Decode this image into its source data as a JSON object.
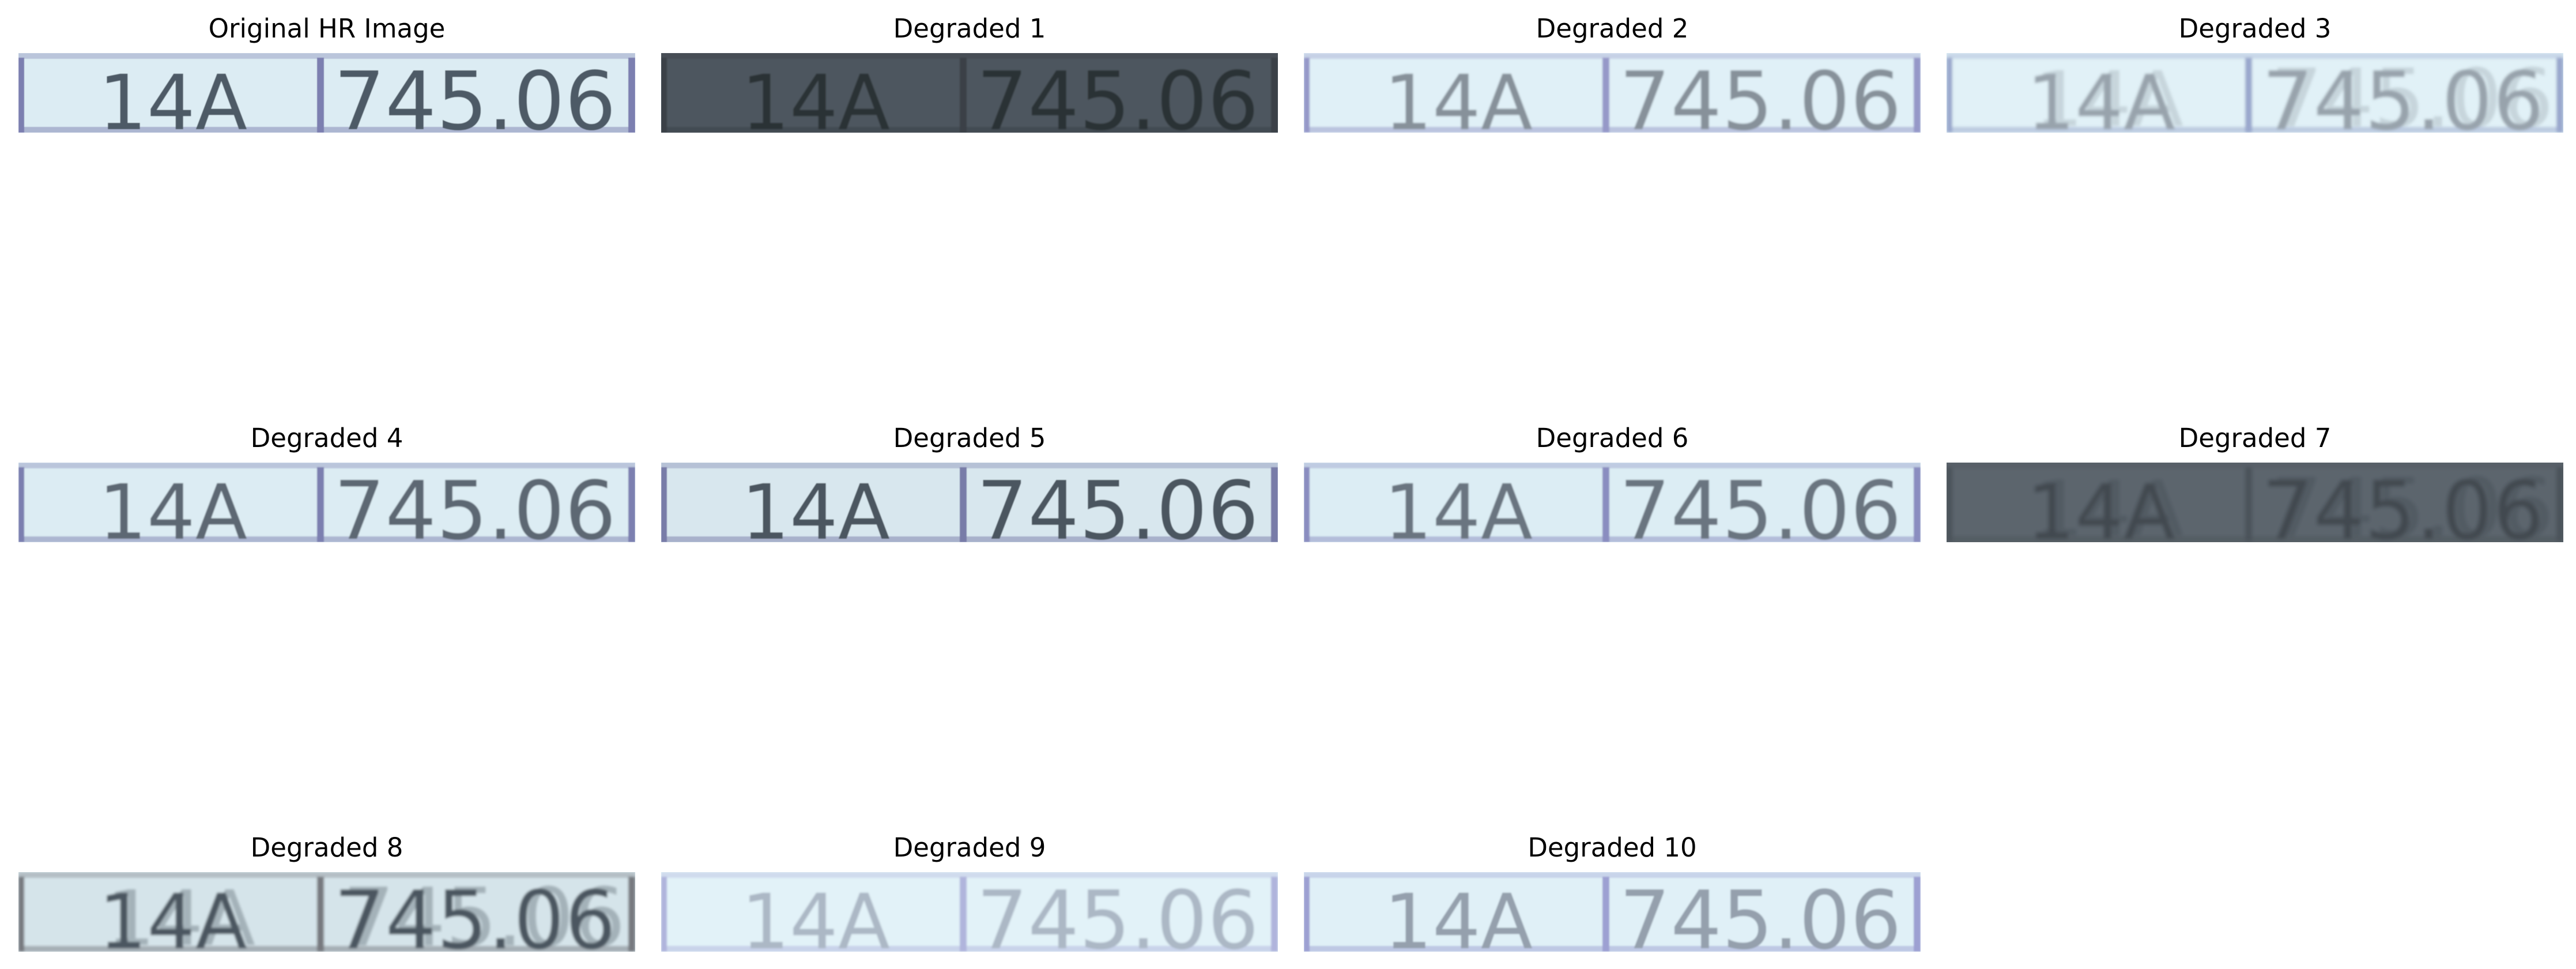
{
  "panels": [
    {
      "title": "Original HR Image",
      "left_text": "14A",
      "right_text": "745.06",
      "bg": "#dcecf3",
      "ink": "#4e5a66",
      "border": "#7b7fb0",
      "blur": 0.6,
      "opacity": 1.0,
      "ghost": false
    },
    {
      "title": "Degraded 1",
      "left_text": "14A",
      "right_text": "745.06",
      "bg": "#4d565e",
      "ink": "#2b3136",
      "border": "#3a4046",
      "blur": 1.2,
      "opacity": 1.0,
      "ghost": false
    },
    {
      "title": "Degraded 2",
      "left_text": "14A",
      "right_text": "745.06",
      "bg": "#e0f0f7",
      "ink": "#7e8791",
      "border": "#8e8fc4",
      "blur": 1.6,
      "opacity": 0.9,
      "ghost": false
    },
    {
      "title": "Degraded 3",
      "left_text": "14A",
      "right_text": "745.06",
      "bg": "#e1f1f7",
      "ink": "#8c96a0",
      "border": "#8e9cc6",
      "blur": 2.4,
      "opacity": 0.85,
      "ghost": true
    },
    {
      "title": "Degraded 4",
      "left_text": "14A",
      "right_text": "745.06",
      "bg": "#dcecf3",
      "ink": "#5d6873",
      "border": "#7b7fb0",
      "blur": 1.0,
      "opacity": 1.0,
      "ghost": false
    },
    {
      "title": "Degraded 5",
      "left_text": "14A",
      "right_text": "745.06",
      "bg": "#d8e7ee",
      "ink": "#4c5661",
      "border": "#787ca8",
      "blur": 0.9,
      "opacity": 1.0,
      "ghost": false
    },
    {
      "title": "Degraded 6",
      "left_text": "14A",
      "right_text": "745.06",
      "bg": "#dcedf4",
      "ink": "#6b7580",
      "border": "#8a8dc0",
      "blur": 1.3,
      "opacity": 1.0,
      "ghost": false
    },
    {
      "title": "Degraded 7",
      "left_text": "14A",
      "right_text": "745.06",
      "bg": "#5c656d",
      "ink": "#3f474e",
      "border": "#4a5158",
      "blur": 3.2,
      "opacity": 0.9,
      "ghost": true
    },
    {
      "title": "Degraded 8",
      "left_text": "14A",
      "right_text": "745.06",
      "bg": "#d5e4ea",
      "ink": "#4c5661",
      "border": "#77797f",
      "blur": 2.2,
      "opacity": 1.0,
      "ghost": true
    },
    {
      "title": "Degraded 9",
      "left_text": "14A",
      "right_text": "745.06",
      "bg": "#e2f2f8",
      "ink": "#a3aebd",
      "border": "#a8aad8",
      "blur": 1.6,
      "opacity": 0.85,
      "ghost": false
    },
    {
      "title": "Degraded 10",
      "left_text": "14A",
      "right_text": "745.06",
      "bg": "#e0f0f7",
      "ink": "#8d98a6",
      "border": "#9698cf",
      "blur": 1.4,
      "opacity": 0.9,
      "ghost": false
    }
  ]
}
